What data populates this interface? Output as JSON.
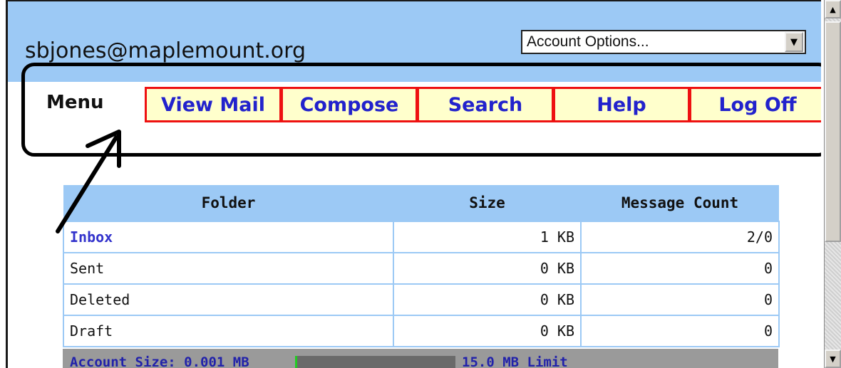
{
  "account": {
    "email": "sbjones@maplemount.org",
    "options_select": "Account Options..."
  },
  "menu": {
    "label": "Menu",
    "tabs": [
      "View Mail",
      "Compose",
      "Search",
      "Help",
      "Log Off"
    ]
  },
  "folders": {
    "headers": [
      "Folder",
      "Size",
      "Message Count"
    ],
    "rows": [
      {
        "name": "Inbox",
        "size": "1 KB",
        "count": "2/0"
      },
      {
        "name": "Sent",
        "size": "0 KB",
        "count": "0"
      },
      {
        "name": "Deleted",
        "size": "0 KB",
        "count": "0"
      },
      {
        "name": "Draft",
        "size": "0 KB",
        "count": "0"
      }
    ]
  },
  "quota": {
    "account_size": "Account Size: 0.001 MB",
    "limit": "15.0 MB Limit"
  },
  "colors": {
    "header_bg": "#9cc9f5",
    "tab_bg": "#ffffcc",
    "tab_border": "#ee1111",
    "tab_text": "#2222cc"
  },
  "icons": {
    "dropdown": "chevron-down-icon",
    "scroll_up": "arrow-up-icon",
    "scroll_down": "arrow-down-icon"
  }
}
